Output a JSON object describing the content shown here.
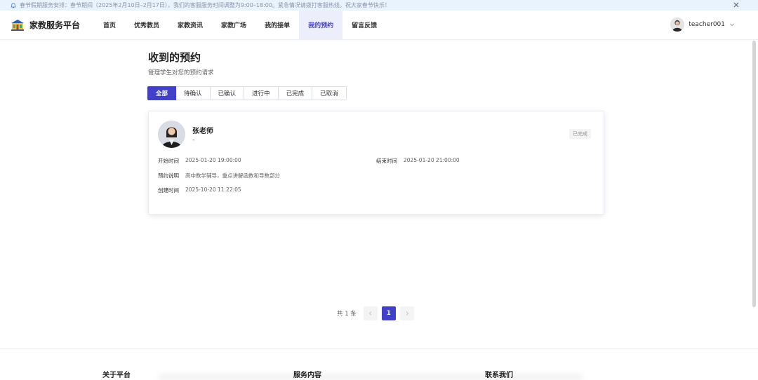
{
  "notice": {
    "text": "春节假期服务安排：春节期间（2025年2月10日–2月17日），我们的客服服务时间调整为9:00–18:00。紧急情况请拨打客服热线。祝大家春节快乐！"
  },
  "header": {
    "brand": "家教服务平台",
    "nav": [
      "首页",
      "优秀教员",
      "家教资讯",
      "家教广场",
      "我的接单",
      "我的预约",
      "留言反馈"
    ],
    "active_nav": "我的预约",
    "username": "teacher001"
  },
  "main": {
    "title": "收到的预约",
    "subtitle": "管理学生对您的预约请求",
    "tabs": [
      "全部",
      "待确认",
      "已确认",
      "进行中",
      "已完成",
      "已取消"
    ],
    "active_tab": "全部"
  },
  "booking": {
    "teacher_name": "张老师",
    "subject": "-",
    "status": "已完成",
    "start_label": "开始时间",
    "start_value": "2025-01-20 19:00:00",
    "end_label": "结束时间",
    "end_value": "2025-01-20 21:00:00",
    "desc_label": "预约说明",
    "desc_value": "高中数学辅导，重点讲解函数和导数部分",
    "created_label": "创建时间",
    "created_value": "2025-10-20 11:22:05"
  },
  "pagination": {
    "total": "共 1 条",
    "current": "1"
  },
  "footer": {
    "col1": "关于平台",
    "col2": "服务内容",
    "col3": "联系我们"
  },
  "colors": {
    "primary": "#4040c8",
    "notice_bg": "#e8f3fe",
    "nav_active_bg": "#eceefb"
  }
}
